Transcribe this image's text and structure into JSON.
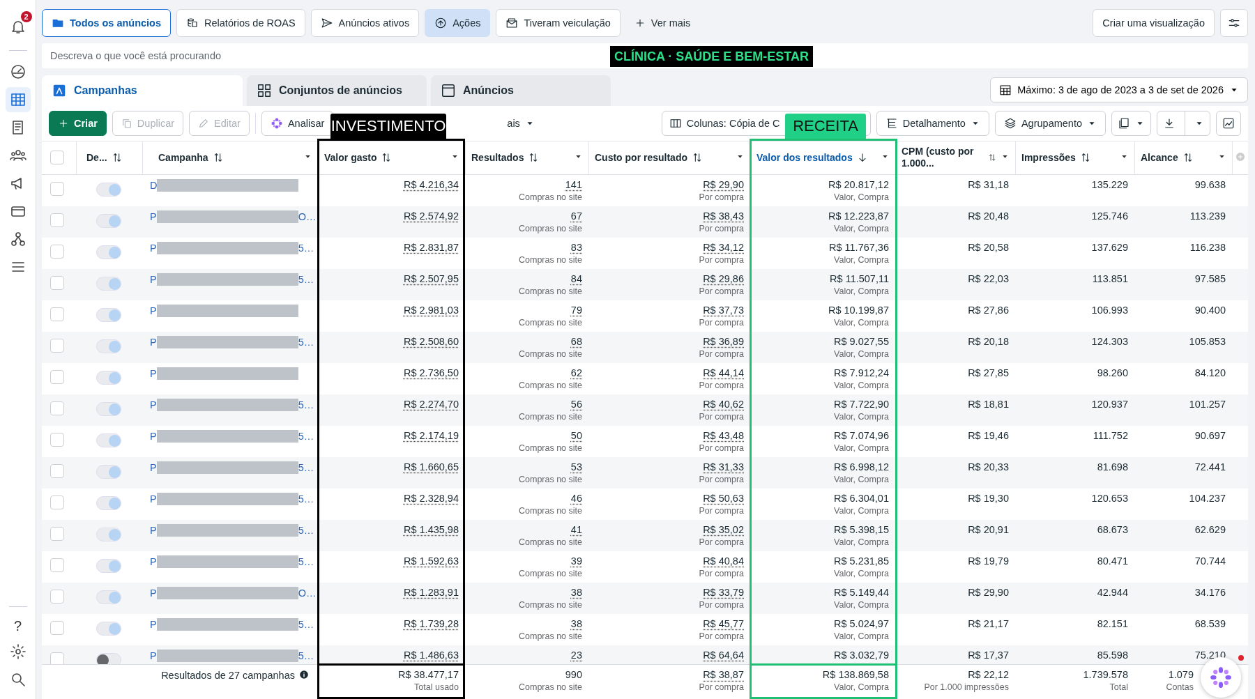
{
  "sidebar": {
    "notification_count": "2",
    "help": "?"
  },
  "view_tabs": [
    {
      "label": "Todos os anúncios",
      "selected": true,
      "pressed": false
    },
    {
      "label": "Relatórios de ROAS",
      "selected": false,
      "pressed": false
    },
    {
      "label": "Anúncios ativos",
      "selected": false,
      "pressed": false
    },
    {
      "label": "Ações",
      "selected": false,
      "pressed": true
    },
    {
      "label": "Tiveram veiculação",
      "selected": false,
      "pressed": false
    }
  ],
  "more_views": "Ver mais",
  "create_view": "Criar uma visualização",
  "search": {
    "placeholder": "Descreva o que você está procurando"
  },
  "level_tabs": [
    {
      "label": "Campanhas",
      "selected": true
    },
    {
      "label": "Conjuntos de anúncios",
      "selected": false
    },
    {
      "label": "Anúncios",
      "selected": false
    }
  ],
  "date_range": "Máximo: 3 de ago de 2023 a 3 de set de 2026",
  "toolbar": {
    "actions": [
      {
        "label": "Criar",
        "kind": "primary",
        "disabled": false
      },
      {
        "label": "Duplicar",
        "kind": "plain",
        "disabled": true
      },
      {
        "label": "Editar",
        "kind": "plain",
        "disabled": true
      },
      {
        "label": "Analisar",
        "kind": "plain",
        "disabled": false
      },
      {
        "label": "ais",
        "kind": "menu",
        "disabled": false
      }
    ],
    "columns": "Colunas: Cópia de C",
    "breakdown": "Detalhamento",
    "grouping": "Agrupamento"
  },
  "table": {
    "select_all_checked": false,
    "columns": [
      {
        "label": "De...",
        "sorted": false
      },
      {
        "label": "Campanha",
        "sorted": false
      },
      {
        "label": "Valor gasto",
        "sorted": false
      },
      {
        "label": "Resultados",
        "sorted": false
      },
      {
        "label": "Custo por resultado",
        "sorted": false
      },
      {
        "label": "Valor dos resultados",
        "sorted": true
      },
      {
        "label": "CPM (custo por 1.000...",
        "sorted": false
      },
      {
        "label": "Impressões",
        "sorted": false
      },
      {
        "label": "Alcance",
        "sorted": false
      }
    ],
    "rows": [
      {
        "checked": false,
        "on": true,
        "name_start": "D",
        "name_end": "",
        "spent": "R$ 4.216,34",
        "results": "141",
        "results_note": "Compras no site",
        "cost": "R$ 29,90",
        "cost_note": "Por compra",
        "value": "R$ 20.817,12",
        "value_note": "Valor, Compra",
        "cpm": "R$ 31,18",
        "impressions": "135.229",
        "reach": "99.638"
      },
      {
        "checked": false,
        "on": true,
        "name_start": "P",
        "name_end": "O…",
        "spent": "R$ 2.574,92",
        "results": "67",
        "results_note": "Compras no site",
        "cost": "R$ 38,43",
        "cost_note": "Por compra",
        "value": "R$ 12.223,87",
        "value_note": "Valor, Compra",
        "cpm": "R$ 20,48",
        "impressions": "125.746",
        "reach": "113.239"
      },
      {
        "checked": false,
        "on": true,
        "name_start": "P",
        "name_end": "5…",
        "spent": "R$ 2.831,87",
        "results": "83",
        "results_note": "Compras no site",
        "cost": "R$ 34,12",
        "cost_note": "Por compra",
        "value": "R$ 11.767,36",
        "value_note": "Valor, Compra",
        "cpm": "R$ 20,58",
        "impressions": "137.629",
        "reach": "116.238"
      },
      {
        "checked": false,
        "on": true,
        "name_start": "P",
        "name_end": "5…",
        "spent": "R$ 2.507,95",
        "results": "84",
        "results_note": "Compras no site",
        "cost": "R$ 29,86",
        "cost_note": "Por compra",
        "value": "R$ 11.507,11",
        "value_note": "Valor, Compra",
        "cpm": "R$ 22,03",
        "impressions": "113.851",
        "reach": "97.585"
      },
      {
        "checked": false,
        "on": true,
        "name_start": "P",
        "name_end": "",
        "spent": "R$ 2.981,03",
        "results": "79",
        "results_note": "Compras no site",
        "cost": "R$ 37,73",
        "cost_note": "Por compra",
        "value": "R$ 10.199,87",
        "value_note": "Valor, Compra",
        "cpm": "R$ 27,86",
        "impressions": "106.993",
        "reach": "90.400"
      },
      {
        "checked": false,
        "on": true,
        "name_start": "P",
        "name_end": "5…",
        "spent": "R$ 2.508,60",
        "results": "68",
        "results_note": "Compras no site",
        "cost": "R$ 36,89",
        "cost_note": "Por compra",
        "value": "R$ 9.027,55",
        "value_note": "Valor, Compra",
        "cpm": "R$ 20,18",
        "impressions": "124.303",
        "reach": "105.853"
      },
      {
        "checked": false,
        "on": true,
        "name_start": "P",
        "name_end": "",
        "spent": "R$ 2.736,50",
        "results": "62",
        "results_note": "Compras no site",
        "cost": "R$ 44,14",
        "cost_note": "Por compra",
        "value": "R$ 7.912,24",
        "value_note": "Valor, Compra",
        "cpm": "R$ 27,85",
        "impressions": "98.260",
        "reach": "84.120"
      },
      {
        "checked": false,
        "on": true,
        "name_start": "P",
        "name_end": "5…",
        "spent": "R$ 2.274,70",
        "results": "56",
        "results_note": "Compras no site",
        "cost": "R$ 40,62",
        "cost_note": "Por compra",
        "value": "R$ 7.722,90",
        "value_note": "Valor, Compra",
        "cpm": "R$ 18,81",
        "impressions": "120.937",
        "reach": "101.257"
      },
      {
        "checked": false,
        "on": true,
        "name_start": "P",
        "name_end": "5…",
        "spent": "R$ 2.174,19",
        "results": "50",
        "results_note": "Compras no site",
        "cost": "R$ 43,48",
        "cost_note": "Por compra",
        "value": "R$ 7.074,96",
        "value_note": "Valor, Compra",
        "cpm": "R$ 19,46",
        "impressions": "111.752",
        "reach": "90.697"
      },
      {
        "checked": false,
        "on": true,
        "name_start": "P",
        "name_end": "5…",
        "spent": "R$ 1.660,65",
        "results": "53",
        "results_note": "Compras no site",
        "cost": "R$ 31,33",
        "cost_note": "Por compra",
        "value": "R$ 6.998,12",
        "value_note": "Valor, Compra",
        "cpm": "R$ 20,33",
        "impressions": "81.698",
        "reach": "72.441"
      },
      {
        "checked": false,
        "on": true,
        "name_start": "P",
        "name_end": "5…",
        "spent": "R$ 2.328,94",
        "results": "46",
        "results_note": "Compras no site",
        "cost": "R$ 50,63",
        "cost_note": "Por compra",
        "value": "R$ 6.304,01",
        "value_note": "Valor, Compra",
        "cpm": "R$ 19,30",
        "impressions": "120.653",
        "reach": "104.237"
      },
      {
        "checked": false,
        "on": true,
        "name_start": "P",
        "name_end": "5…",
        "spent": "R$ 1.435,98",
        "results": "41",
        "results_note": "Compras no site",
        "cost": "R$ 35,02",
        "cost_note": "Por compra",
        "value": "R$ 5.398,15",
        "value_note": "Valor, Compra",
        "cpm": "R$ 20,91",
        "impressions": "68.673",
        "reach": "62.629"
      },
      {
        "checked": false,
        "on": true,
        "name_start": "P",
        "name_end": "5…",
        "spent": "R$ 1.592,63",
        "results": "39",
        "results_note": "Compras no site",
        "cost": "R$ 40,84",
        "cost_note": "Por compra",
        "value": "R$ 5.231,85",
        "value_note": "Valor, Compra",
        "cpm": "R$ 19,79",
        "impressions": "80.471",
        "reach": "70.744"
      },
      {
        "checked": false,
        "on": true,
        "name_start": "P",
        "name_end": "O…",
        "spent": "R$ 1.283,91",
        "results": "38",
        "results_note": "Compras no site",
        "cost": "R$ 33,79",
        "cost_note": "Por compra",
        "value": "R$ 5.149,44",
        "value_note": "Valor, Compra",
        "cpm": "R$ 29,90",
        "impressions": "42.944",
        "reach": "34.176"
      },
      {
        "checked": false,
        "on": true,
        "name_start": "P",
        "name_end": "5…",
        "spent": "R$ 1.739,28",
        "results": "38",
        "results_note": "Compras no site",
        "cost": "R$ 45,77",
        "cost_note": "Por compra",
        "value": "R$ 5.024,97",
        "value_note": "Valor, Compra",
        "cpm": "R$ 21,17",
        "impressions": "82.151",
        "reach": "68.539"
      },
      {
        "checked": false,
        "on": false,
        "name_start": "P",
        "name_end": "5…",
        "spent": "R$ 1.486,63",
        "results": "23",
        "cost": "R$ 64,64",
        "value": "R$ 3.032,79",
        "cpm": "R$ 17,37",
        "impressions": "85.598",
        "reach": "75.210"
      }
    ],
    "footer": {
      "label": "Resultados de 27 campanhas",
      "cells": [
        {
          "value": "R$ 38.477,17",
          "note": "Total usado"
        },
        {
          "value": "990",
          "note": "Compras no site"
        },
        {
          "value": "R$ 38,87",
          "note": "Por compra"
        },
        {
          "value": "R$ 138.869,58",
          "note": "Valor, Compra"
        },
        {
          "value": "R$ 22,12",
          "note": "Por 1.000 impressões"
        },
        {
          "value": "1.739.578",
          "note": "Total"
        },
        {
          "value": "1.079",
          "note": "Contas"
        }
      ]
    }
  },
  "annotations": [
    {
      "text": "CLÍNICA · SAÚDE E BEM-ESTAR",
      "kind": "banner"
    },
    {
      "text": "INVESTIMENTO",
      "kind": "dark"
    },
    {
      "text": "RECEITA",
      "kind": "green"
    }
  ]
}
